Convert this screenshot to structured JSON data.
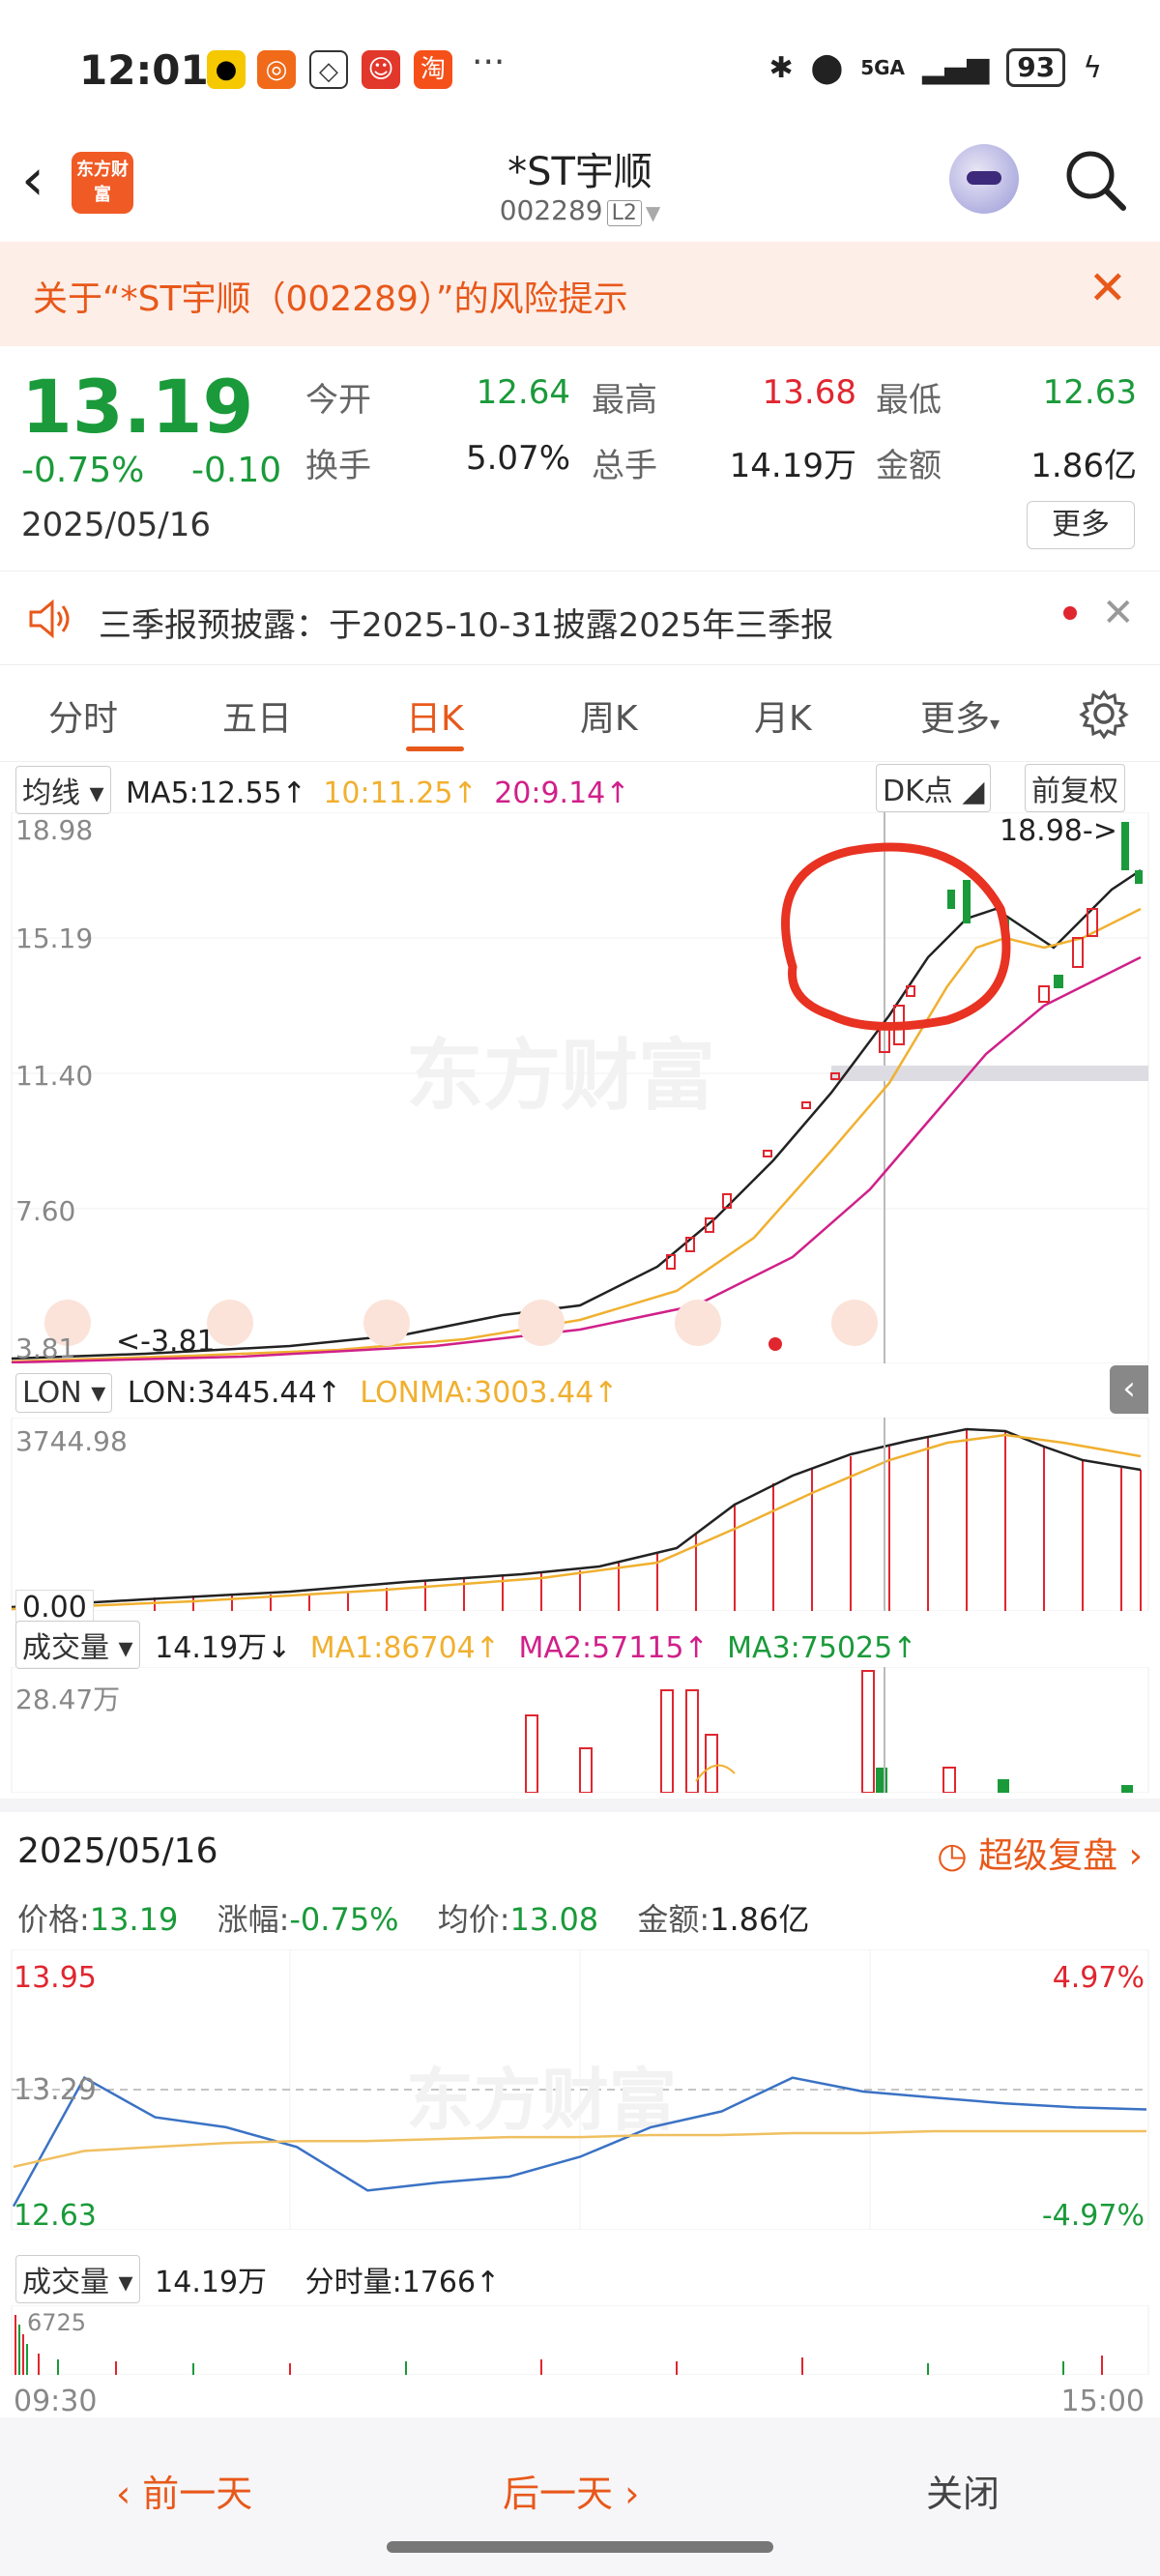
{
  "status_bar": {
    "time": "12:01",
    "network": "5GA",
    "battery": "93"
  },
  "header": {
    "title": "*ST宇顺",
    "code": "002289",
    "level": "L2",
    "logo": "东方财富"
  },
  "risk_banner": {
    "text": "关于“*ST宇顺（002289）”的风险提示"
  },
  "quote": {
    "price": "13.19",
    "change_pct": "-0.75%",
    "change": "-0.10",
    "date": "2025/05/16",
    "fields": [
      {
        "label": "今开",
        "value": "12.64",
        "color": "#1a9a3a"
      },
      {
        "label": "最高",
        "value": "13.68",
        "color": "#e0262f"
      },
      {
        "label": "最低",
        "value": "12.63",
        "color": "#1a9a3a"
      },
      {
        "label": "换手",
        "value": "5.07%",
        "color": "#222"
      },
      {
        "label": "总手",
        "value": "14.19万",
        "color": "#222"
      },
      {
        "label": "金额",
        "value": "1.86亿",
        "color": "#222"
      }
    ],
    "more_label": "更多"
  },
  "notice": {
    "text": "三季报预披露：于2025-10-31披露2025年三季报"
  },
  "tabs": [
    "分时",
    "五日",
    "日K",
    "周K",
    "月K",
    "更多"
  ],
  "active_tab": "日K",
  "kline": {
    "ma_select": "均线",
    "ma5": "MA5:12.55↑",
    "ma10": "10:11.25↑",
    "ma20": "20:9.14↑",
    "dk_label": "DK点",
    "adjust_label": "前复权",
    "y_ticks": [
      "18.98",
      "15.19",
      "11.40",
      "7.60",
      "3.81"
    ],
    "max_label": "18.98->",
    "min_label": "<-3.81",
    "watermark": "东方财富"
  },
  "lon": {
    "select": "LON",
    "lon": "LON:3445.44↑",
    "lonma": "LONMA:3003.44↑",
    "y_top": "3744.98",
    "y_bottom": "0.00"
  },
  "volume": {
    "select": "成交量",
    "vol": "14.19万↓",
    "ma1": "MA1:86704↑",
    "ma2": "MA2:57115↑",
    "ma3": "MA3:75025↑",
    "y_top": "28.47万"
  },
  "detail": {
    "date": "2025/05/16",
    "replay": "超级复盘",
    "price_label": "价格:",
    "price": "13.19",
    "chg_label": "涨幅:",
    "chg": "-0.75%",
    "avg_label": "均价:",
    "avg": "13.08",
    "amt_label": "金额:",
    "amt": "1.86亿",
    "hi": "13.95",
    "mid": "13.29",
    "lo": "12.63",
    "hi_pct": "4.97%",
    "lo_pct": "-4.97%",
    "vol_select": "成交量",
    "vol_total": "14.19万",
    "vol_minute": "分时量:1766↑",
    "vol_top": "6725",
    "t_start": "09:30",
    "t_end": "15:00"
  },
  "footer": {
    "prev": "前一天",
    "next": "后一天",
    "close": "关闭"
  },
  "chart_data": {
    "type": "line",
    "title": "",
    "x": [
      "09:30",
      "09:45",
      "10:00",
      "10:15",
      "10:30",
      "10:45",
      "11:00",
      "11:15",
      "11:30",
      "13:15",
      "13:30",
      "13:45",
      "14:00",
      "14:15",
      "14:30",
      "14:45",
      "15:00"
    ],
    "series": [
      {
        "name": "价格",
        "values": [
          12.7,
          13.35,
          13.15,
          13.1,
          13.0,
          12.78,
          12.82,
          12.85,
          12.95,
          13.1,
          13.18,
          13.35,
          13.28,
          13.25,
          13.22,
          13.2,
          13.19
        ]
      },
      {
        "name": "均价",
        "values": [
          12.9,
          12.98,
          13.0,
          13.02,
          13.03,
          13.03,
          13.04,
          13.05,
          13.05,
          13.06,
          13.06,
          13.07,
          13.07,
          13.08,
          13.08,
          13.08,
          13.08
        ]
      }
    ],
    "ylim": [
      12.63,
      13.95
    ]
  }
}
